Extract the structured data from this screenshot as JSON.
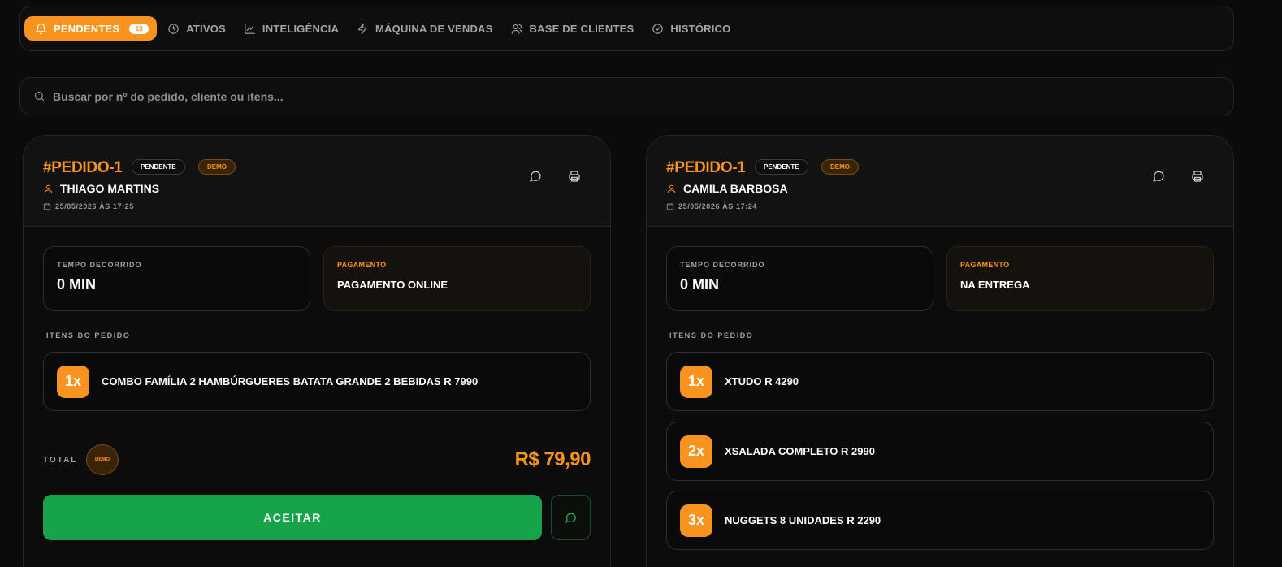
{
  "nav": {
    "items": [
      {
        "label": "PENDENTES",
        "icon": "bell-icon",
        "badge": "13",
        "active": true
      },
      {
        "label": "ATIVOS",
        "icon": "clock-icon"
      },
      {
        "label": "INTELIGÊNCIA",
        "icon": "line-chart-icon"
      },
      {
        "label": "MÁQUINA DE VENDAS",
        "icon": "lightning-icon"
      },
      {
        "label": "BASE DE CLIENTES",
        "icon": "users-icon"
      },
      {
        "label": "HISTÓRICO",
        "icon": "check-circle-icon"
      }
    ]
  },
  "search": {
    "placeholder": "Buscar por nº do pedido, cliente ou itens..."
  },
  "colors": {
    "accent": "#f7931e",
    "success": "#16a34a"
  },
  "orders": [
    {
      "id": "#PEDIDO-1",
      "status": "PENDENTE",
      "demo": "DEMO",
      "customer": "THIAGO MARTINS",
      "datetime": "25/05/2026 ÀS 17:25",
      "elapsed_label": "TEMPO DECORRIDO",
      "elapsed_value": "0 MIN",
      "payment_label": "PAGAMENTO",
      "payment_value": "PAGAMENTO ONLINE",
      "items_label": "ITENS DO PEDIDO",
      "items": [
        {
          "qty": "1x",
          "name": "COMBO FAMÍLIA 2 HAMBÚRGUERES BATATA GRANDE 2 BEBIDAS R 7990"
        }
      ],
      "total_label": "TOTAL",
      "total_demo": "DEMO",
      "total_value": "R$ 79,90",
      "accept_label": "ACEITAR"
    },
    {
      "id": "#PEDIDO-1",
      "status": "PENDENTE",
      "demo": "DEMO",
      "customer": "CAMILA BARBOSA",
      "datetime": "25/05/2026 ÀS 17:24",
      "elapsed_label": "TEMPO DECORRIDO",
      "elapsed_value": "0 MIN",
      "payment_label": "PAGAMENTO",
      "payment_value": "NA ENTREGA",
      "items_label": "ITENS DO PEDIDO",
      "items": [
        {
          "qty": "1x",
          "name": "XTUDO R 4290"
        },
        {
          "qty": "2x",
          "name": "XSALADA COMPLETO R 2990"
        },
        {
          "qty": "3x",
          "name": "NUGGETS 8 UNIDADES R 2290"
        }
      ]
    }
  ]
}
